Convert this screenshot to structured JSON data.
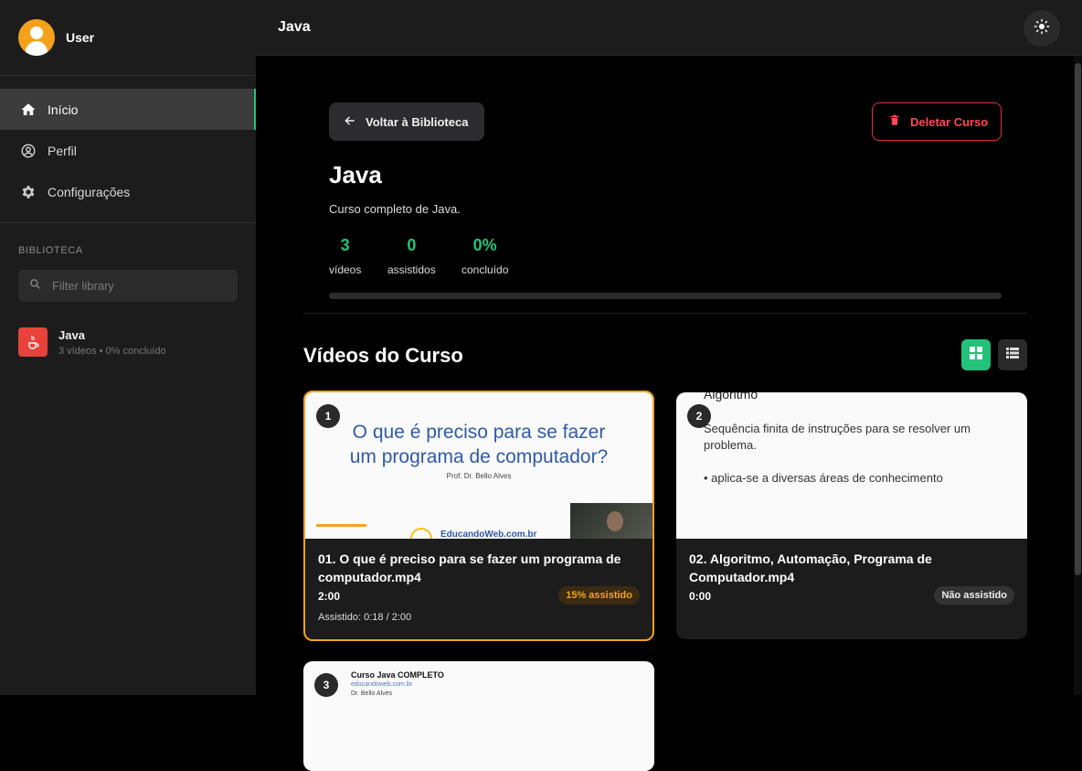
{
  "user": {
    "name": "User"
  },
  "nav": {
    "items": [
      {
        "label": "Início",
        "icon": "home-icon"
      },
      {
        "label": "Perfil",
        "icon": "profile-icon"
      },
      {
        "label": "Configurações",
        "icon": "gear-icon"
      }
    ]
  },
  "library": {
    "section_label": "BIBLIOTECA",
    "filter_placeholder": "Filter library",
    "items": [
      {
        "title": "Java",
        "meta": "3 vídeos • 0% concluído"
      }
    ]
  },
  "header": {
    "title": "Java"
  },
  "course": {
    "back_label": "Voltar à Biblioteca",
    "delete_label": "Deletar Curso",
    "title": "Java",
    "description": "Curso completo de Java.",
    "stats": [
      {
        "value": "3",
        "label": "vídeos"
      },
      {
        "value": "0",
        "label": "assistidos"
      },
      {
        "value": "0%",
        "label": "concluído"
      }
    ],
    "progress_percent": 0
  },
  "videos": {
    "section_title": "Vídeos do Curso",
    "items": [
      {
        "number": "1",
        "title": "01. O que é preciso para se fazer um programa de computador.mp4",
        "duration": "2:00",
        "badge": "15% assistido",
        "watched": "Assistido: 0:18 / 2:00",
        "thumb": {
          "title": "O que é preciso para se fazer um programa de computador?",
          "subtitle": "Prof. Dr. Bello Alves",
          "url": "EducandoWeb.com.br"
        }
      },
      {
        "number": "2",
        "title": "02. Algoritmo, Automação, Programa de Computador.mp4",
        "duration": "0:00",
        "badge": "Não assistido",
        "thumb": {
          "heading": "Algoritmo",
          "line1": "Sequência finita de instruções para se resolver um",
          "line2": "problema.",
          "line3": "• aplica-se a diversas áreas de conhecimento"
        }
      },
      {
        "number": "3",
        "thumb": {
          "title": "Curso Java COMPLETO",
          "line1": "educandoweb.com.br",
          "line2": "Dr. Bello Alves"
        }
      }
    ]
  },
  "colors": {
    "accent": "#22c27a",
    "warning": "#f4a21b",
    "danger": "#ff4757",
    "sidebar": "#1c1c1c"
  }
}
